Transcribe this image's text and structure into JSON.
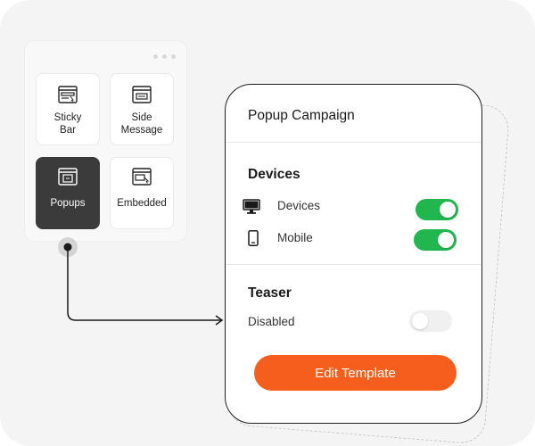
{
  "palette": {
    "tiles": [
      {
        "label": "Sticky\nBar",
        "icon": "sticky-bar-icon"
      },
      {
        "label": "Side\nMessage",
        "icon": "side-message-icon"
      },
      {
        "label": "Popups",
        "icon": "popups-icon",
        "active": true
      },
      {
        "label": "Embedded",
        "icon": "embedded-icon"
      }
    ]
  },
  "card": {
    "title": "Popup Campaign",
    "devices_section": {
      "title": "Devices",
      "rows": [
        {
          "label": "Devices",
          "icon": "desktop-icon",
          "enabled": true
        },
        {
          "label": "Mobile",
          "icon": "mobile-icon",
          "enabled": true
        }
      ]
    },
    "teaser_section": {
      "title": "Teaser",
      "label": "Disabled",
      "enabled": false
    },
    "cta_label": "Edit Template"
  },
  "colors": {
    "accent": "#f55e1c",
    "toggle_on": "#22b64f",
    "active_tile": "#3b3b3b"
  }
}
